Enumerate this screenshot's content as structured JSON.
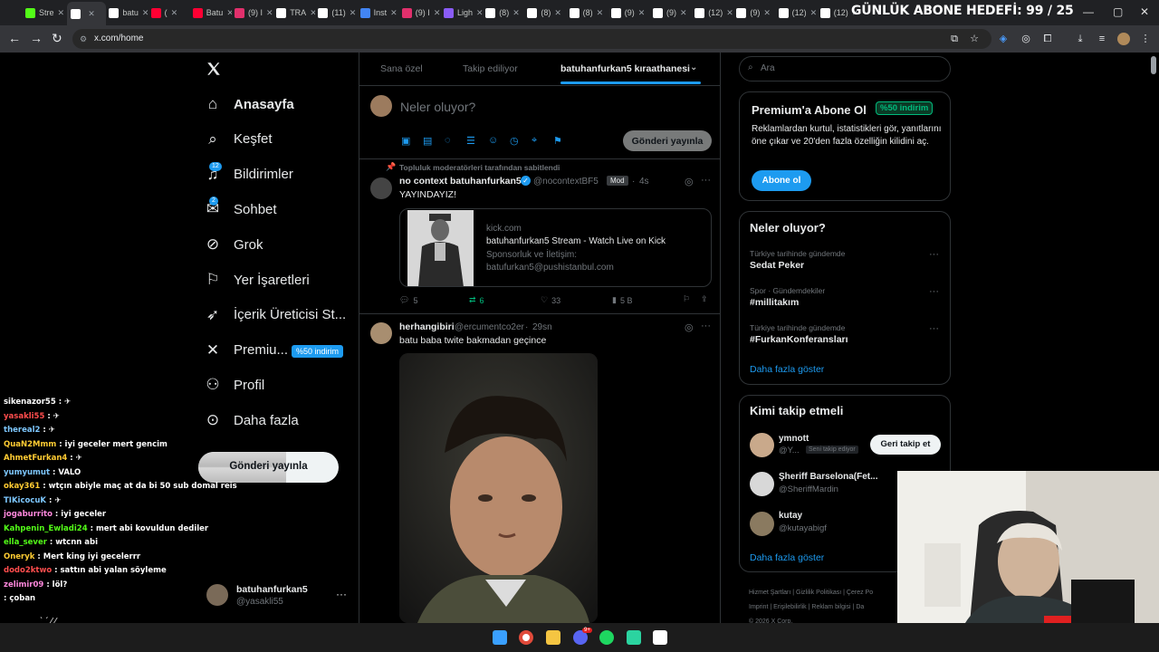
{
  "browser": {
    "tabs": [
      {
        "label": "Stre",
        "color": "#53fc18"
      },
      {
        "label": "",
        "color": "#ffffff",
        "active": true
      },
      {
        "label": "batu",
        "color": "#ffffff"
      },
      {
        "label": "(",
        "color": "#ff0033"
      },
      {
        "label": "Batu",
        "color": "#ff0033"
      },
      {
        "label": "(9) I",
        "color": "#e1306c"
      },
      {
        "label": "TRA",
        "color": "#ffffff"
      },
      {
        "label": "(11)",
        "color": "#ffffff"
      },
      {
        "label": "Inst",
        "color": "#4285f4"
      },
      {
        "label": "(9) I",
        "color": "#e1306c"
      },
      {
        "label": "Ligh",
        "color": "#8a5cf6"
      },
      {
        "label": "(8)",
        "color": "#ffffff"
      },
      {
        "label": "(8)",
        "color": "#ffffff"
      },
      {
        "label": "(8)",
        "color": "#ffffff"
      },
      {
        "label": "(9)",
        "color": "#ffffff"
      },
      {
        "label": "(9)",
        "color": "#ffffff"
      },
      {
        "label": "(12)",
        "color": "#ffffff"
      },
      {
        "label": "(9)",
        "color": "#ffffff"
      },
      {
        "label": "(12)",
        "color": "#ffffff"
      },
      {
        "label": "(12)",
        "color": "#ffffff"
      }
    ],
    "url": "x.com/home",
    "overlay_title": "GÜNLÜK ABONE HEDEFİ: 99 / 25"
  },
  "sidebar": {
    "logo": "X",
    "items": [
      {
        "label": "Anasayfa",
        "icon": "home-icon",
        "bold": true
      },
      {
        "label": "Keşfet",
        "icon": "search-icon"
      },
      {
        "label": "Bildirimler",
        "icon": "bell-icon",
        "badge": "12"
      },
      {
        "label": "Sohbet",
        "icon": "chat-icon",
        "badge": "2"
      },
      {
        "label": "Grok",
        "icon": "grok-icon"
      },
      {
        "label": "Yer İşaretleri",
        "icon": "bookmark-icon"
      },
      {
        "label": "İçerik Üreticisi St...",
        "icon": "rocket-icon"
      },
      {
        "label": "Premiu...",
        "icon": "x-icon",
        "badge": "%50 indirim"
      },
      {
        "label": "Profil",
        "icon": "person-icon"
      },
      {
        "label": "Daha fazla",
        "icon": "more-icon"
      }
    ],
    "post_button": "Gönderi yayınla",
    "account": {
      "name": "batuhanfurkan5",
      "handle": "@yasakli55"
    }
  },
  "chat": [
    {
      "user": "sikenazor55",
      "color": "#ffffff",
      "msg": ": ✈"
    },
    {
      "user": "yasakli55",
      "color": "#ff4d4d",
      "msg": ": ✈"
    },
    {
      "user": "thereal2",
      "color": "#7ec8ff",
      "msg": ": ✈"
    },
    {
      "user": "QuaN2Mmm",
      "color": "#ffcc33",
      "msg": ": iyi geceler mert gencim"
    },
    {
      "user": "AhmetFurkan4",
      "color": "#ffcc33",
      "msg": ": ✈"
    },
    {
      "user": "yumyumut",
      "color": "#7ec8ff",
      "msg": ": VALO"
    },
    {
      "user": "okay361",
      "color": "#ffcc33",
      "msg": ": wtçın abiyle maç at da bi 50 sub domal reis"
    },
    {
      "user": "TIKicocuK",
      "color": "#7ec8ff",
      "msg": ": ✈"
    },
    {
      "user": "jogaburrito",
      "color": "#ff88dd",
      "msg": ": iyi geceler"
    },
    {
      "user": "Kahpenin_Ewladi24",
      "color": "#53fc18",
      "msg": ": mert abi kovuldun dediler"
    },
    {
      "user": "ella_sever",
      "color": "#53fc18",
      "msg": ": wtcnn abi"
    },
    {
      "user": "Oneryk",
      "color": "#ffcc33",
      "msg": ": Mert king iyi gecelerrr"
    },
    {
      "user": "dodo2ktwo",
      "color": "#ff4d4d",
      "msg": ": sattın abi yalan söyleme"
    },
    {
      "user": "zelimir09",
      "color": "#ff88dd",
      "msg": ": löl?"
    },
    {
      "user": "",
      "color": "#ffffff",
      "msg": ": çoban"
    }
  ],
  "feed": {
    "tabs": [
      "Sana özel",
      "Takip ediliyor",
      "batuhanfurkan5 kıraathanesi"
    ],
    "composer_placeholder": "Neler oluyor?",
    "composer_button": "Gönderi yayınla",
    "pinned_label": "Topluluk moderatörleri tarafından sabitlendi",
    "tweet1": {
      "name": "no context batuhanfurkan5",
      "handle": "@nocontextBF5",
      "role": "Mod",
      "time": "4s",
      "text": "YAYINDAYIZ!",
      "card_domain": "kick.com",
      "card_title": "batuhanfurkan5 Stream - Watch Live on Kick",
      "card_desc1": "Sponsorluk ve İletişim:",
      "card_desc2": "batufurkan5@pushistanbul.com",
      "replies": "5",
      "reposts": "6",
      "likes": "33",
      "views": "5 B"
    },
    "tweet2": {
      "name": "herhangibiri",
      "handle": "@ercumentco2er",
      "time": "29sn",
      "text": "batu baba twite bakmadan geçince"
    }
  },
  "right": {
    "search_placeholder": "Ara",
    "premium": {
      "title": "Premium'a Abone Ol",
      "badge": "%50 indirim",
      "desc": "Reklamlardan kurtul, istatistikleri gör, yanıtlarını öne çıkar ve 20'den fazla özelliğin kilidini aç.",
      "button": "Abone ol"
    },
    "trends": {
      "title": "Neler oluyor?",
      "items": [
        {
          "category": "Türkiye tarihinde gündemde",
          "name": "Sedat Peker"
        },
        {
          "category": "Spor · Gündemdekiler",
          "name": "#millitakım"
        },
        {
          "category": "Türkiye tarihinde gündemde",
          "name": "#FurkanKonferansları"
        }
      ],
      "more": "Daha fazla göster"
    },
    "who_to_follow": {
      "title": "Kimi takip etmeli",
      "users": [
        {
          "name": "ymnott",
          "handle": "@Y...",
          "tag": "Seni takip ediyor",
          "button": "Geri takip et"
        },
        {
          "name": "Şheriff Barselona(Fet...",
          "handle": "@SheriffMardin"
        },
        {
          "name": "kutay",
          "handle": "@kutayabigf"
        }
      ],
      "more": "Daha fazla göster"
    },
    "footer": [
      "Hizmet Şartları",
      "Gizlilik Politikası",
      "Çerez Po",
      "Imprint",
      "Erişilebilirlik",
      "Reklam bilgisi",
      "Da",
      "© 2026 X Corp."
    ]
  },
  "taskbar": {
    "discord_badge": "9+"
  }
}
